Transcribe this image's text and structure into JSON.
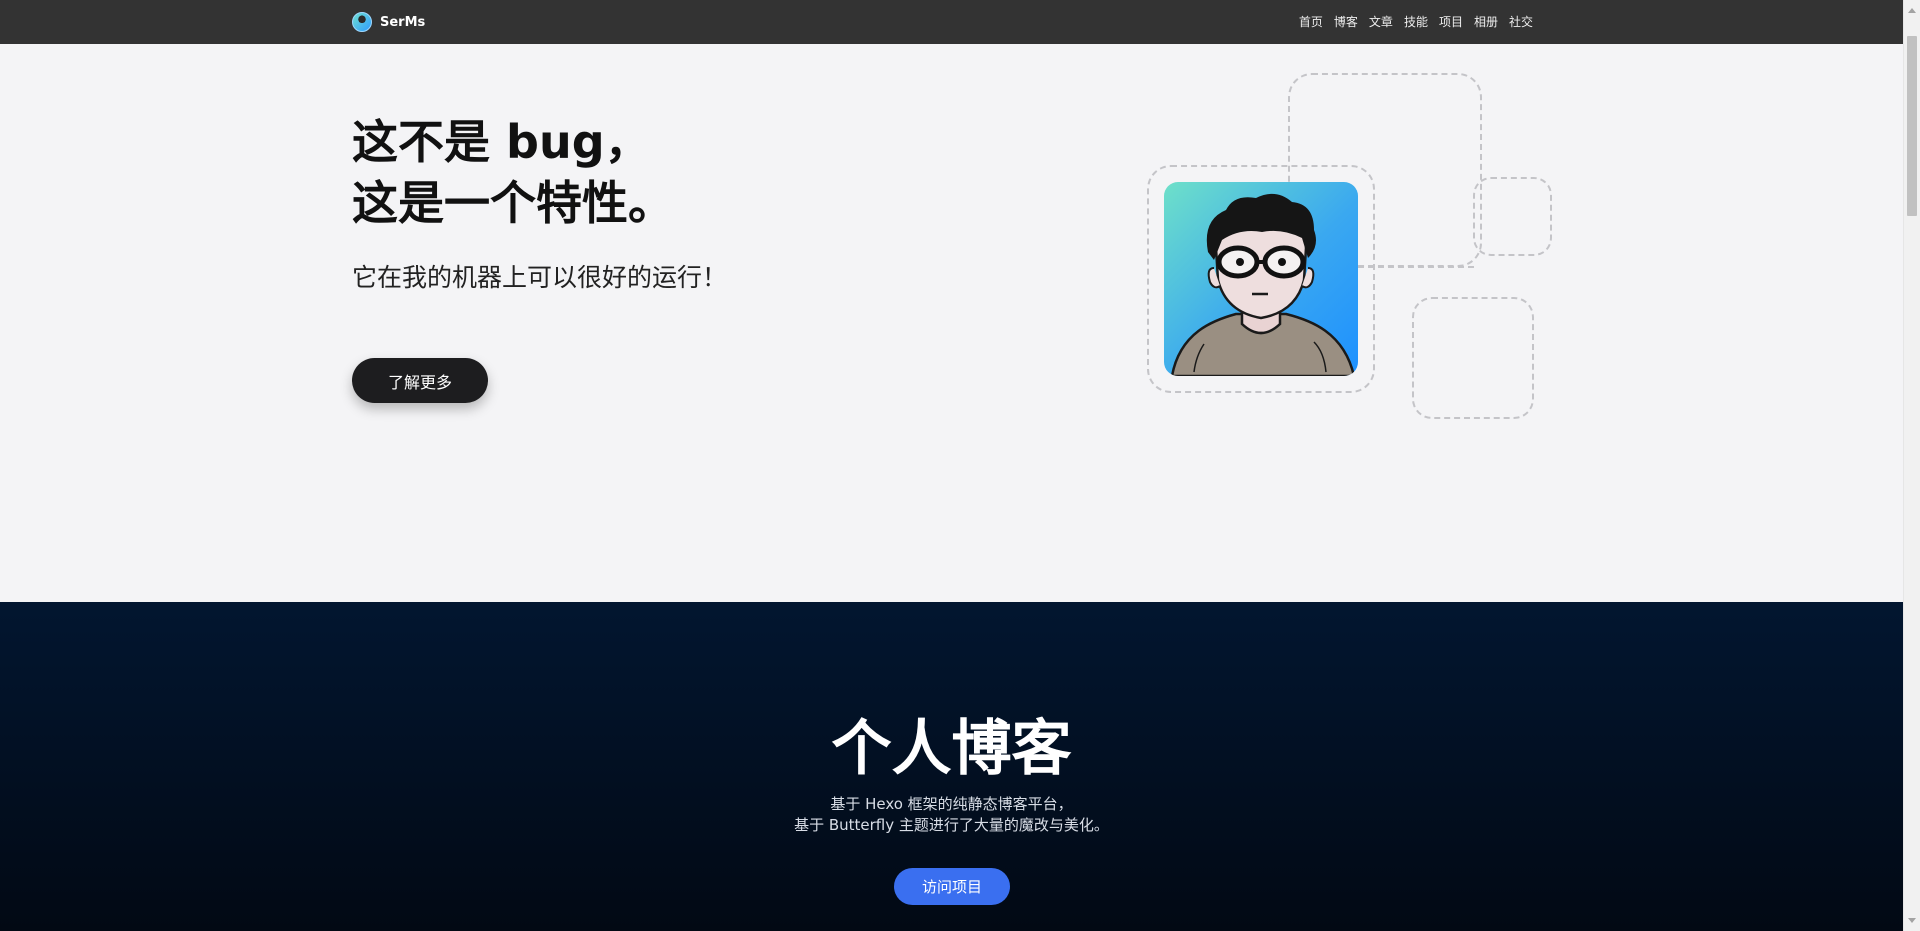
{
  "nav": {
    "brand": "SerMs",
    "items": [
      "首页",
      "博客",
      "文章",
      "技能",
      "项目",
      "相册",
      "社交"
    ]
  },
  "hero": {
    "title_line1": "这不是 bug，",
    "title_line2": "这是一个特性。",
    "subtitle": "它在我的机器上可以很好的运行！",
    "cta": "了解更多"
  },
  "blog_section": {
    "title": "个人博客",
    "desc_line1": "基于 Hexo 框架的纯静态博客平台，",
    "desc_line2": "基于 Butterfly 主题进行了大量的魔改与美化。",
    "cta": "访问项目"
  },
  "colors": {
    "nav_bg": "#333333",
    "hero_bg": "#f4f4f6",
    "dark_bg": "#021630",
    "accent": "#3a6ff0"
  }
}
